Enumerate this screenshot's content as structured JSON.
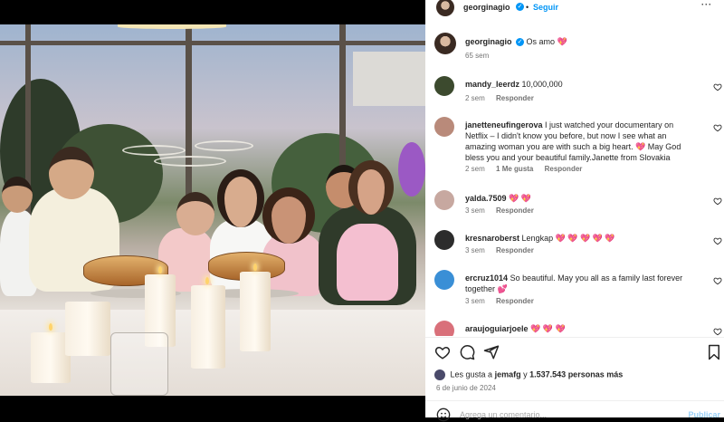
{
  "post": {
    "owner": "georginagio",
    "follow_label": "Seguir",
    "caption_text": "Os amo",
    "caption_emoji": "💖",
    "caption_time": "65 sem"
  },
  "comments": [
    {
      "user": "mandy_leerdz",
      "text": "10,000,000",
      "time": "2 sem",
      "likes": "",
      "reply": "Responder",
      "avatar_color": "#3c4a2e"
    },
    {
      "user": "janetteneufingerova",
      "text": "I just watched your documentary on Netflix – I didn't know you before, but now I see what an amazing woman you are with such a big heart. 💖 May God bless you and your beautiful family.Janette from Slovakia",
      "time": "2 sem",
      "likes": "1 Me gusta",
      "reply": "Responder",
      "avatar_color": "#b98a7a"
    },
    {
      "user": "yalda.7509",
      "text": "💖 💖",
      "time": "3 sem",
      "likes": "",
      "reply": "Responder",
      "avatar_color": "#c7a8a0"
    },
    {
      "user": "kresnaroberst",
      "text": "Lengkap 💖 💖 💖 💖 💖",
      "time": "3 sem",
      "likes": "",
      "reply": "Responder",
      "avatar_color": "#2c2c2c"
    },
    {
      "user": "ercruz1014",
      "text": "So beautiful. May you all as a family last forever together 💕",
      "time": "3 sem",
      "likes": "",
      "reply": "Responder",
      "avatar_color": "#3a8fd6"
    },
    {
      "user": "araujoguiarjoele",
      "text": "💖 💖 💖",
      "time": "",
      "likes": "",
      "reply": "",
      "avatar_color": "#d9707a"
    }
  ],
  "actions": {
    "like_icon": "heart-outline-icon",
    "comment_icon": "comment-bubble-icon",
    "share_icon": "paper-plane-icon",
    "save_icon": "bookmark-icon"
  },
  "likes": {
    "prefix": "Les gusta a",
    "user": "jemafg",
    "middle": "y",
    "count": "1.537.543",
    "suffix": "personas más"
  },
  "date": "6 de junio de 2024",
  "add_comment": {
    "placeholder": "Agrega un comentario...",
    "publish": "Publicar"
  },
  "colors": {
    "accent": "#0095f6",
    "heart": "#ff3d7f",
    "muted": "#737373"
  }
}
